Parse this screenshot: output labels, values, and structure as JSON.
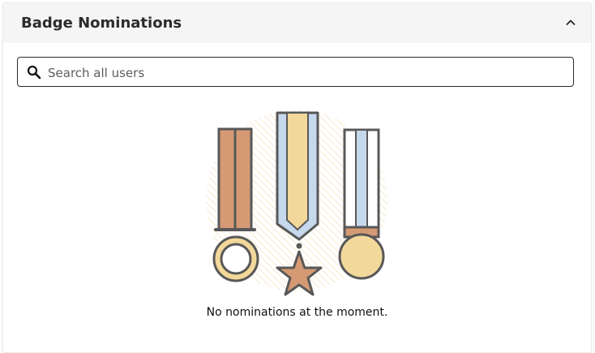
{
  "panel": {
    "title": "Badge Nominations",
    "collapse_icon": "chevron-up-icon"
  },
  "search": {
    "placeholder": "Search all users",
    "value": "",
    "icon": "search-icon"
  },
  "empty_state": {
    "illustration": "medals-illustration",
    "message": "No nominations at the moment."
  },
  "colors": {
    "header_bg": "#f5f5f6",
    "outline": "#585858",
    "bronze": "#d59a74",
    "gold": "#f2d89a",
    "silver_blue": "#c5d8ec",
    "hatch": "#f4e7c9"
  }
}
